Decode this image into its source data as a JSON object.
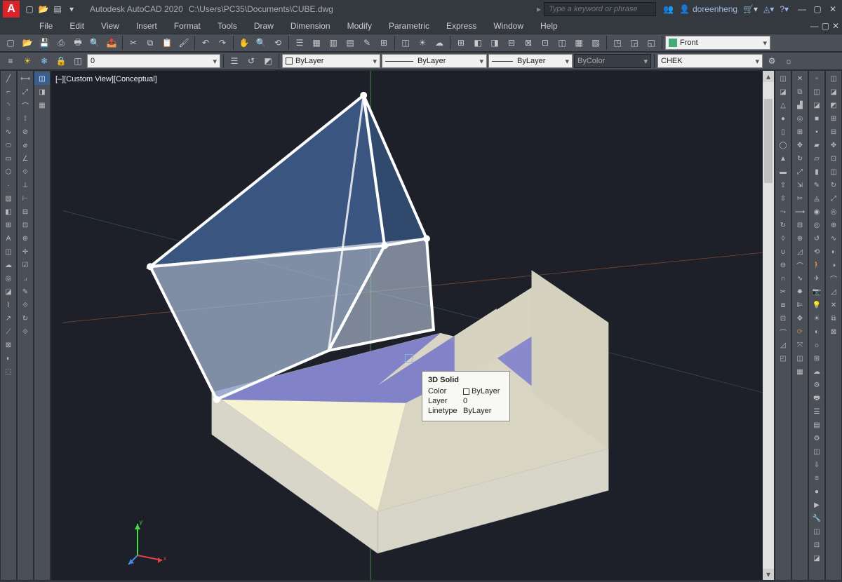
{
  "title": "Autodesk AutoCAD 2020",
  "filepath": "C:\\Users\\PC35\\Documents\\CUBE.dwg",
  "search_placeholder": "Type a keyword or phrase",
  "user": "doreenheng",
  "menu": [
    "File",
    "Edit",
    "View",
    "Insert",
    "Format",
    "Tools",
    "Draw",
    "Dimension",
    "Modify",
    "Parametric",
    "Express",
    "Window",
    "Help"
  ],
  "layer_combo": "0",
  "linetype_combo": "ByLayer",
  "lineweight_combo": "ByLayer",
  "plot_combo": "ByLayer",
  "color_combo": "ByColor",
  "style_combo": "CHEK",
  "view_combo": "Front",
  "viewport_label": "[–][Custom View][Conceptual]",
  "tooltip": {
    "title": "3D Solid",
    "rows": [
      {
        "label": "Color",
        "value": "ByLayer",
        "swatch": true
      },
      {
        "label": "Layer",
        "value": "0"
      },
      {
        "label": "Linetype",
        "value": "ByLayer"
      }
    ]
  }
}
